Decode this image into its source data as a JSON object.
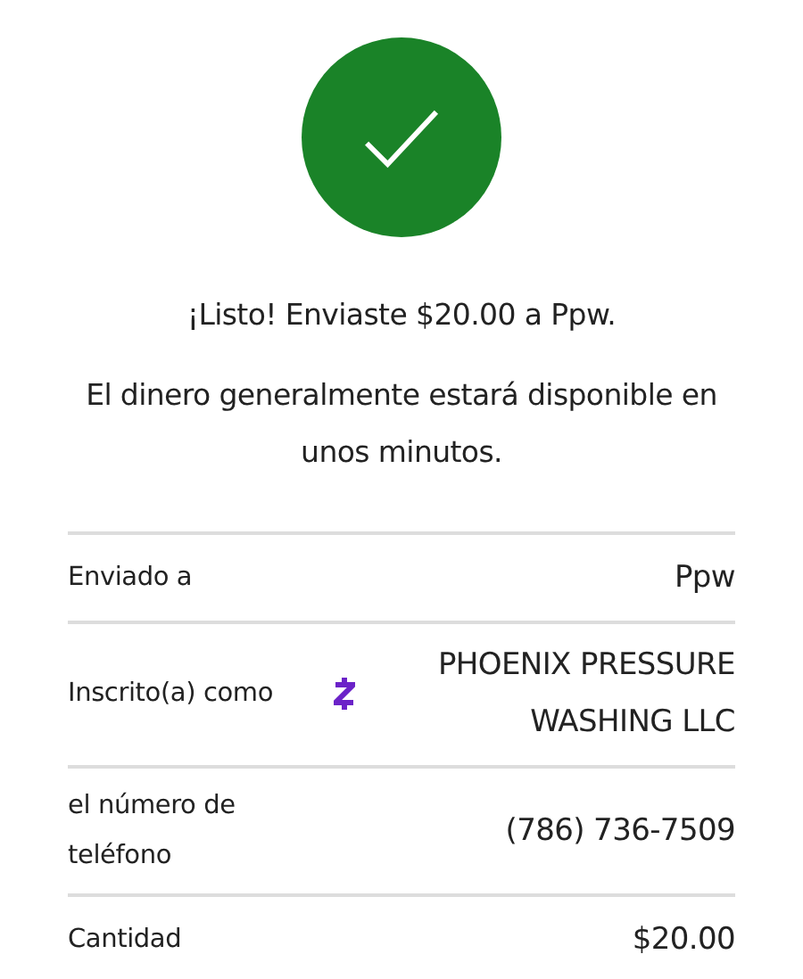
{
  "status": {
    "kind": "success"
  },
  "message": "¡Listo! Enviaste $20.00 a Ppw.",
  "note": "El dinero generalmente estará disponible en unos minutos.",
  "details": [
    {
      "label": "Enviado a",
      "value": "Ppw",
      "kind": "text"
    },
    {
      "label": "Inscrito(a) como",
      "value": "PHOENIX PRESSURE WASHING LLC",
      "kind": "verified"
    },
    {
      "label": "el número de teléfono",
      "value": "(786) 736-7509",
      "kind": "text"
    },
    {
      "label": "Cantidad",
      "value": "$20.00",
      "kind": "text"
    }
  ]
}
